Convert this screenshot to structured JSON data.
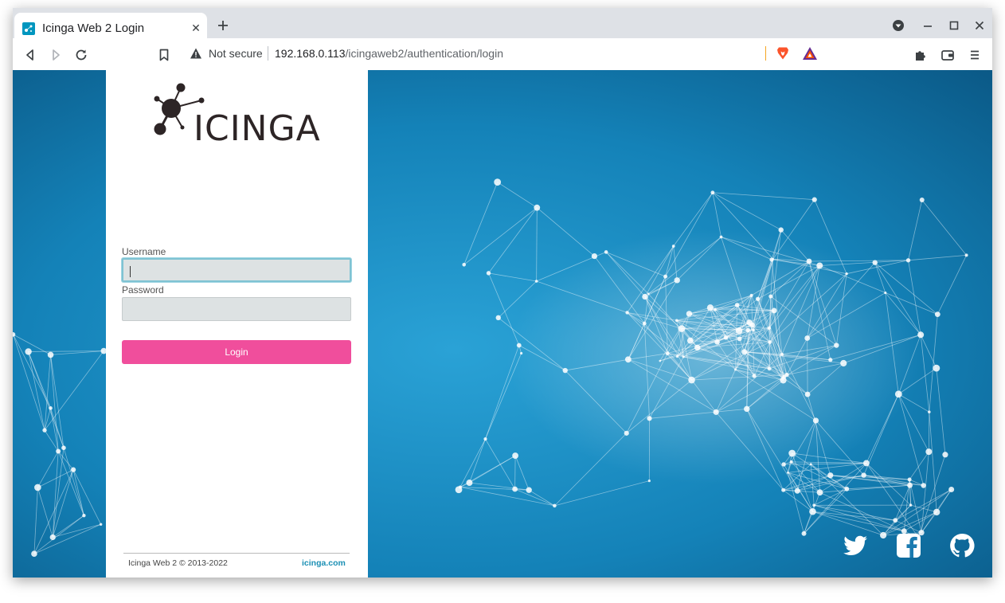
{
  "browser": {
    "tab_title": "Icinga Web 2 Login",
    "tab_close_glyph": "✕",
    "security_text": "Not secure",
    "url_host": "192.168.0.113",
    "url_path": "/icingaweb2/authentication/login"
  },
  "login": {
    "username_label": "Username",
    "username_value": "",
    "password_label": "Password",
    "password_value": "",
    "login_button": "Login"
  },
  "footer": {
    "copyright": "Icinga Web 2 © 2013-2022",
    "link": "icinga.com"
  },
  "logo": {
    "text": "ICINGA"
  },
  "colors": {
    "accent": "#f04e9c",
    "link": "#1a8fb4",
    "background": "#0f6a9a",
    "logo": "#2d2526"
  },
  "icons": {
    "social": [
      "twitter-icon",
      "facebook-icon",
      "github-icon"
    ]
  }
}
